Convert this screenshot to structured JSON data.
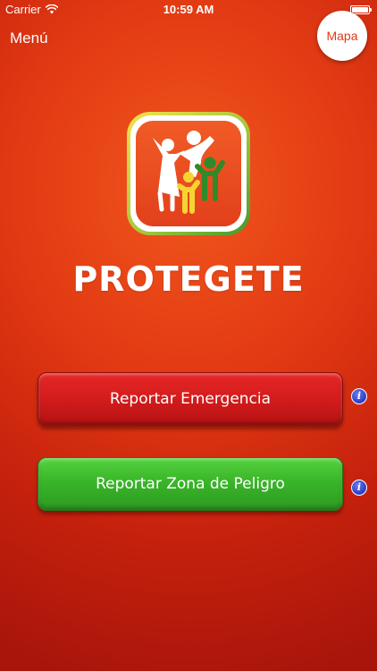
{
  "status_bar": {
    "carrier": "Carrier",
    "time": "10:59 AM",
    "battery_level": 1.0
  },
  "nav": {
    "menu_label": "Menú",
    "map_label": "Mapa"
  },
  "app": {
    "title": "PROTEGETE"
  },
  "actions": {
    "report_emergency_label": "Reportar Emergencia",
    "report_danger_zone_label": "Reportar Zona de Peligro",
    "info_glyph": "i"
  },
  "colors": {
    "background": "#e23a13",
    "emergency_button": "#d61d1d",
    "danger_zone_button": "#3ab52a",
    "info_icon": "#3244c9",
    "map_text": "#e23a13"
  },
  "icons": {
    "wifi": "wifi-icon",
    "battery": "battery-icon",
    "info": "info-icon",
    "logo": "family-logo-icon"
  }
}
